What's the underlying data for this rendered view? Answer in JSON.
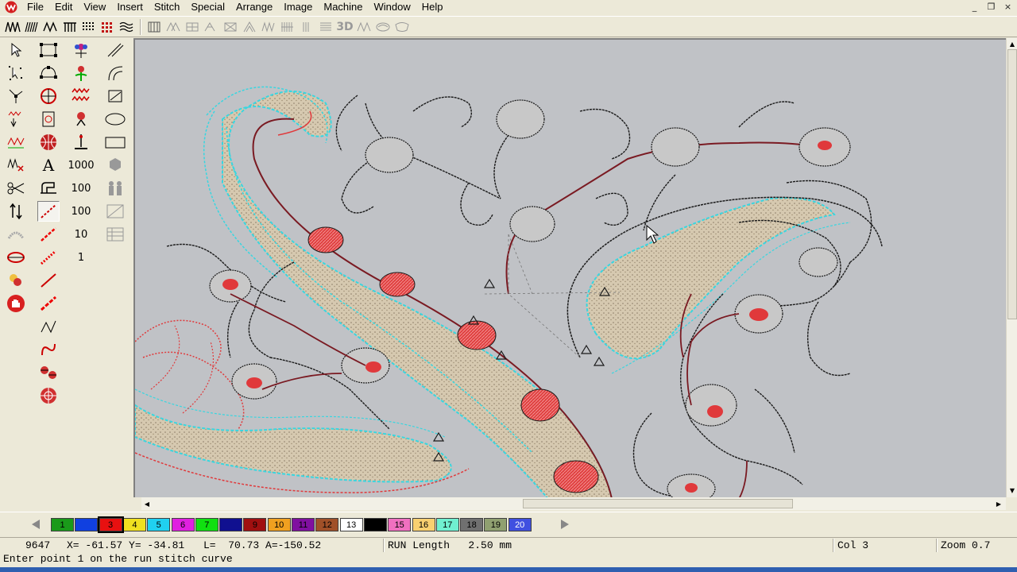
{
  "menu": [
    "File",
    "Edit",
    "View",
    "Insert",
    "Stitch",
    "Special",
    "Arrange",
    "Image",
    "Machine",
    "Window",
    "Help"
  ],
  "window_controls": [
    "_",
    "❐",
    "×"
  ],
  "toolbar": {
    "left_icons": [
      "zigzag-stitch-icon",
      "satin-stitch-icon",
      "run-zigzag-icon",
      "column-stitch-icon",
      "fill-grid-icon",
      "fill-dots-icon",
      "wave-fill-icon"
    ],
    "right_icons": [
      "grid-select-icon",
      "motif-fill-icon",
      "pattern-fill-icon",
      "hatch-fill-icon",
      "cross-fill-icon",
      "triangle-fill-icon",
      "zigzag-fill-icon",
      "stripe-fill-icon",
      "line-fill-icon",
      "bar-fill-icon"
    ],
    "label_3d": "3D",
    "tail_icons": [
      "wave-3d-icon",
      "emboss-icon",
      "applique-icon"
    ]
  },
  "palette": {
    "texts": {
      "letter_a": "A",
      "count_1000": "1000",
      "count_100a": "100",
      "count_100b": "100",
      "count_10": "10",
      "count_1": "1"
    }
  },
  "colors": {
    "canvas": "#c0c2c6",
    "thread_red": "#e0393b",
    "thread_cyan": "#38d6e0",
    "thread_black": "#1a1a1a",
    "thread_maroon": "#7a1a22",
    "fill_beige": "#d8cbb2"
  },
  "thread_palette": [
    {
      "label": "1",
      "color": "#1a9a1a",
      "text": "#000"
    },
    {
      "label": "",
      "color": "#1040e0",
      "text": "#fff"
    },
    {
      "label": "3",
      "color": "#e81010",
      "text": "#000",
      "active": true
    },
    {
      "label": "4",
      "color": "#f0e020",
      "text": "#000"
    },
    {
      "label": "5",
      "color": "#20d0f0",
      "text": "#000"
    },
    {
      "label": "6",
      "color": "#e020e0",
      "text": "#000"
    },
    {
      "label": "7",
      "color": "#10e010",
      "text": "#000"
    },
    {
      "label": "",
      "color": "#101090",
      "text": "#fff"
    },
    {
      "label": "9",
      "color": "#a01010",
      "text": "#000"
    },
    {
      "label": "10",
      "color": "#f0a020",
      "text": "#000"
    },
    {
      "label": "11",
      "color": "#8010a0",
      "text": "#000"
    },
    {
      "label": "12",
      "color": "#a05028",
      "text": "#000"
    },
    {
      "label": "13",
      "color": "#ffffff",
      "text": "#000"
    },
    {
      "label": "",
      "color": "#000000",
      "text": "#fff"
    },
    {
      "label": "15",
      "color": "#f070c0",
      "text": "#000"
    },
    {
      "label": "16",
      "color": "#f8d070",
      "text": "#000"
    },
    {
      "label": "17",
      "color": "#70f0d0",
      "text": "#000"
    },
    {
      "label": "18",
      "color": "#707070",
      "text": "#000"
    },
    {
      "label": "19",
      "color": "#90a070",
      "text": "#000"
    },
    {
      "label": "20",
      "color": "#4050e0",
      "text": "#fff"
    }
  ],
  "status": {
    "count": "9647",
    "xy": "X= -61.57 Y= -34.81",
    "length_angle": "L=  70.73 A=-150.52",
    "stitch": "RUN Length   2.50 mm",
    "col": "Col 3",
    "zoom": "Zoom 0.7",
    "prompt": "Enter point 1 on the run stitch curve"
  }
}
